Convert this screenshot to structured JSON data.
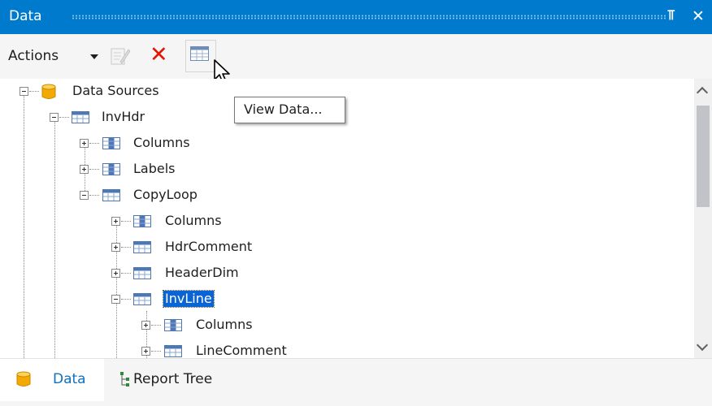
{
  "panel": {
    "title": "Data"
  },
  "toolbar": {
    "actions_label": "Actions"
  },
  "tooltip": {
    "text": "View Data..."
  },
  "tree": {
    "nodes": [
      {
        "label": "Data Sources",
        "icon": "database-icon",
        "expanded": true
      },
      {
        "label": "InvHdr",
        "icon": "table-icon",
        "expanded": true
      },
      {
        "label": "Columns",
        "icon": "columns-icon",
        "expanded": false
      },
      {
        "label": "Labels",
        "icon": "columns-icon",
        "expanded": false
      },
      {
        "label": "CopyLoop",
        "icon": "table-icon",
        "expanded": true
      },
      {
        "label": "Columns",
        "icon": "columns-icon",
        "expanded": false
      },
      {
        "label": "HdrComment",
        "icon": "table-icon",
        "expanded": false
      },
      {
        "label": "HeaderDim",
        "icon": "table-icon",
        "expanded": false
      },
      {
        "label": "InvLine",
        "icon": "table-icon",
        "expanded": true,
        "selected": true
      },
      {
        "label": "Columns",
        "icon": "columns-icon",
        "expanded": false
      },
      {
        "label": "LineComment",
        "icon": "table-icon",
        "expanded": false
      }
    ]
  },
  "tabs": [
    {
      "label": "Data",
      "icon": "database-icon",
      "active": true
    },
    {
      "label": "Report Tree",
      "icon": "tree-icon",
      "active": false
    }
  ],
  "colors": {
    "titlebar": "#007acc",
    "selection": "#0a64d6",
    "delete": "#e51400",
    "active_tab_text": "#0e70c0"
  }
}
